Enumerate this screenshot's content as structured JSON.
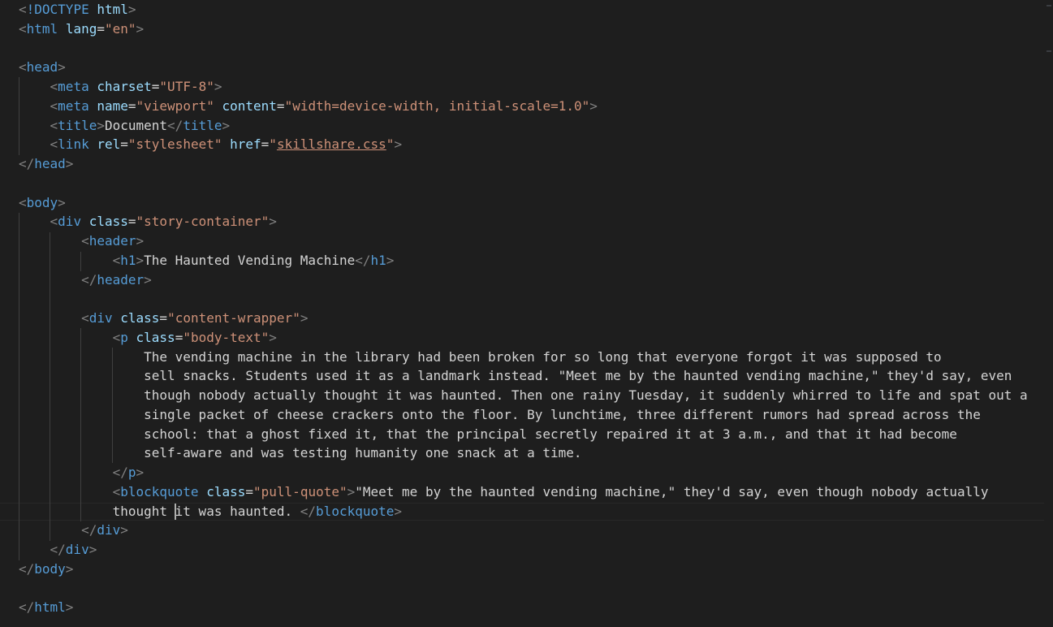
{
  "editor": {
    "language": "html",
    "theme": {
      "background": "#1e1e1e",
      "tag": "#569cd6",
      "attribute": "#9cdcfe",
      "string": "#ce9178",
      "punctuation": "#808080",
      "text": "#d4d4d4"
    },
    "code": {
      "doctype_kw": "!DOCTYPE",
      "html_tag": "html",
      "lang_attr": "lang",
      "lang_val": "\"en\"",
      "head_tag": "head",
      "meta_tag": "meta",
      "charset_attr": "charset",
      "charset_val": "\"UTF-8\"",
      "name_attr": "name",
      "name_val": "\"viewport\"",
      "content_attr": "content",
      "content_val": "\"width=device-width, initial-scale=1.0\"",
      "title_tag": "title",
      "title_text": "Document",
      "link_tag": "link",
      "rel_attr": "rel",
      "rel_val": "\"stylesheet\"",
      "href_attr": "href",
      "href_link": "skillshare.css",
      "body_tag": "body",
      "div_tag": "div",
      "class_attr": "class",
      "story_container_val": "\"story-container\"",
      "header_tag": "header",
      "h1_tag": "h1",
      "h1_text": "The Haunted Vending Machine",
      "content_wrapper_val": "\"content-wrapper\"",
      "p_tag": "p",
      "body_text_val": "\"body-text\"",
      "para_lines": [
        "The vending machine in the library had been broken for so long that everyone forgot it was supposed to",
        "sell snacks. Students used it as a landmark instead. \"Meet me by the haunted vending machine,\" they'd say, even",
        "though nobody actually thought it was haunted. Then one rainy Tuesday, it suddenly whirred to life and spat out a",
        "single packet of cheese crackers onto the floor. By lunchtime, three different rumors had spread across the",
        "school: that a ghost fixed it, that the principal secretly repaired it at 3 a.m., and that it had become",
        "self-aware and was testing humanity one snack at a time."
      ],
      "blockquote_tag": "blockquote",
      "pull_quote_val": "\"pull-quote\"",
      "quote_line1": "\"Meet me by the haunted vending machine,\" they'd say, even though nobody actually",
      "quote_line2": "thought it was haunted. "
    }
  }
}
